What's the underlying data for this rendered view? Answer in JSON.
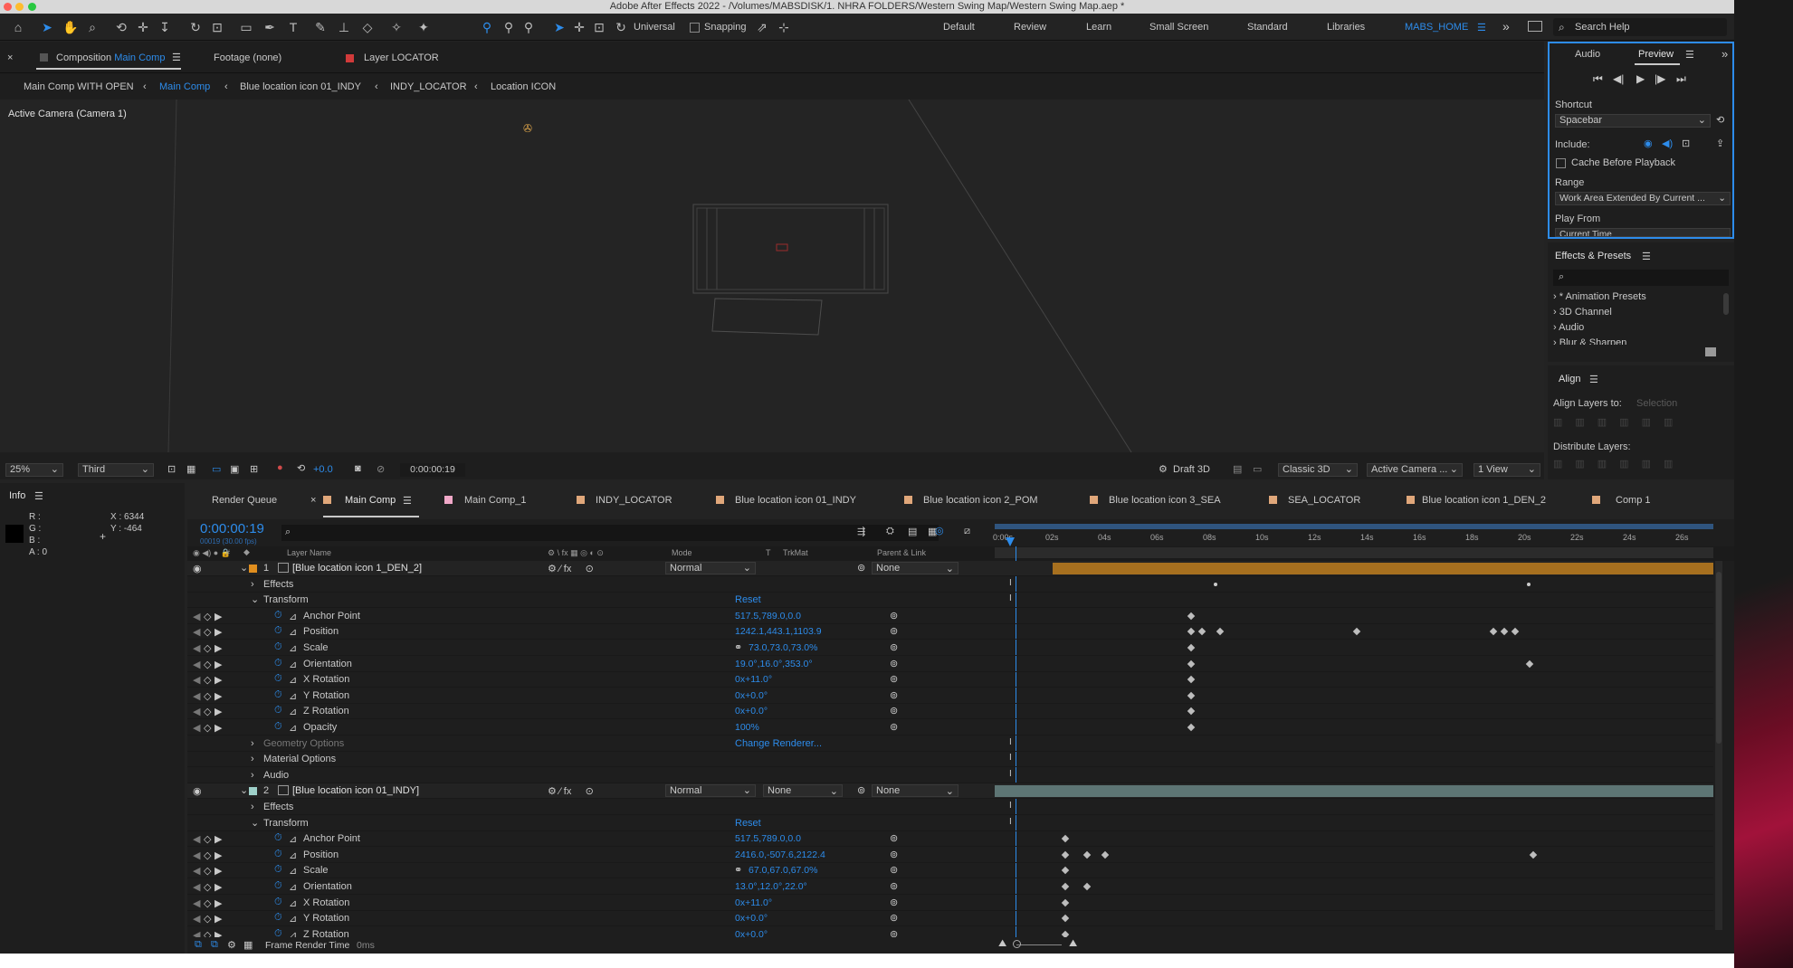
{
  "titlebar": {
    "title": "Adobe After Effects 2022 - /Volumes/MABSDISK/1. NHRA FOLDERS/Western Swing Map/Western Swing Map.aep *"
  },
  "toolbar": {
    "universal": "Universal",
    "snapping": "Snapping"
  },
  "workspaces": [
    "Default",
    "Review",
    "Learn",
    "Small Screen",
    "Standard",
    "Libraries",
    "MABS_HOME"
  ],
  "search": {
    "placeholder": "Search Help"
  },
  "comp_panel": {
    "tab_prefix": "Composition",
    "tab_name": "Main Comp",
    "footage_tab": "Footage (none)",
    "layer_tab": "Layer LOCATOR",
    "breadcrumbs": [
      "Main Comp WITH OPEN",
      "Main Comp",
      "Blue location icon 01_INDY",
      "INDY_LOCATOR",
      "Location ICON"
    ],
    "viewport_label": "Active Camera (Camera 1)",
    "zoom": "25%",
    "resolution": "Third",
    "exposure": "+0.0",
    "timecode": "0:00:00:19",
    "renderer_toggle": "Draft 3D",
    "renderer": "Classic 3D",
    "camera": "Active Camera ...",
    "views": "1 View"
  },
  "preview_panel": {
    "tab_audio": "Audio",
    "tab_preview": "Preview",
    "shortcut_label": "Shortcut",
    "shortcut_value": "Spacebar",
    "include_label": "Include:",
    "cache_label": "Cache Before Playback",
    "range_label": "Range",
    "range_value": "Work Area Extended By Current ...",
    "play_from_label": "Play From",
    "play_from_value": "Current Time"
  },
  "effects_panel": {
    "title": "Effects & Presets",
    "items": [
      "* Animation Presets",
      "3D Channel",
      "Audio",
      "Blur & Sharpen"
    ]
  },
  "align_panel": {
    "title": "Align",
    "align_to_label": "Align Layers to:",
    "align_to_value": "Selection",
    "distribute_label": "Distribute Layers:"
  },
  "info_panel": {
    "title": "Info",
    "r": "R :",
    "g": "G :",
    "b": "B :",
    "a": "A : 0",
    "x": "X : 6344",
    "y": "Y : -464"
  },
  "timeline": {
    "tabs": [
      "Render Queue",
      "Main Comp",
      "Main Comp_1",
      "INDY_LOCATOR",
      "Blue location icon 01_INDY",
      "Blue location icon 2_POM",
      "Blue location icon 3_SEA",
      "SEA_LOCATOR",
      "Blue location icon 1_DEN_2",
      "Comp 1"
    ],
    "timecode": "0:00:00:19",
    "fps": "00019 (30.00 fps)",
    "headers": {
      "num": "#",
      "layer_name": "Layer Name",
      "mode": "Mode",
      "t": "T",
      "trkmat": "TrkMat",
      "parent": "Parent & Link"
    },
    "ruler": [
      "0:00s",
      "02s",
      "04s",
      "06s",
      "08s",
      "10s",
      "12s",
      "14s",
      "16s",
      "18s",
      "20s",
      "22s",
      "24s",
      "26s"
    ],
    "layers": [
      {
        "num": "1",
        "name": "[Blue location icon 1_DEN_2]",
        "mode": "Normal",
        "trkmat": "",
        "parent": "None",
        "color": "#e08e1e",
        "bar_color": "#a7701f",
        "bar_start": 0.08,
        "bar_end": 1.0
      },
      {
        "num": "2",
        "name": "[Blue location icon 01_INDY]",
        "mode": "Normal",
        "trkmat": "None",
        "parent": "None",
        "color": "#9ed0c9",
        "bar_color": "#5d7574",
        "bar_start": 0.0,
        "bar_end": 1.0
      }
    ],
    "groups": {
      "effects": "Effects",
      "transform": "Transform",
      "reset": "Reset",
      "geometry": "Geometry Options",
      "change_renderer": "Change Renderer...",
      "material": "Material Options",
      "audio": "Audio"
    },
    "props1": [
      {
        "name": "Anchor Point",
        "value": "517.5,789.0,0.0"
      },
      {
        "name": "Position",
        "value": "1242.1,443.1,1103.9"
      },
      {
        "name": "Scale",
        "value": "73.0,73.0,73.0%"
      },
      {
        "name": "Orientation",
        "value": "19.0°,16.0°,353.0°"
      },
      {
        "name": "X Rotation",
        "value": "0x+11.0°"
      },
      {
        "name": "Y Rotation",
        "value": "0x+0.0°"
      },
      {
        "name": "Z Rotation",
        "value": "0x+0.0°"
      },
      {
        "name": "Opacity",
        "value": "100%"
      }
    ],
    "props2": [
      {
        "name": "Anchor Point",
        "value": "517.5,789.0,0.0"
      },
      {
        "name": "Position",
        "value": "2416.0,-507.6,2122.4"
      },
      {
        "name": "Scale",
        "value": "67.0,67.0,67.0%"
      },
      {
        "name": "Orientation",
        "value": "13.0°,12.0°,22.0°"
      },
      {
        "name": "X Rotation",
        "value": "0x+11.0°"
      },
      {
        "name": "Y Rotation",
        "value": "0x+0.0°"
      },
      {
        "name": "Z Rotation",
        "value": "0x+0.0°"
      }
    ],
    "footer": {
      "render_time_label": "Frame Render Time",
      "render_time_value": "0ms"
    }
  },
  "colors": {
    "accent": "#2d8ceb",
    "panel": "#1e1e1e",
    "bg": "#232323"
  }
}
